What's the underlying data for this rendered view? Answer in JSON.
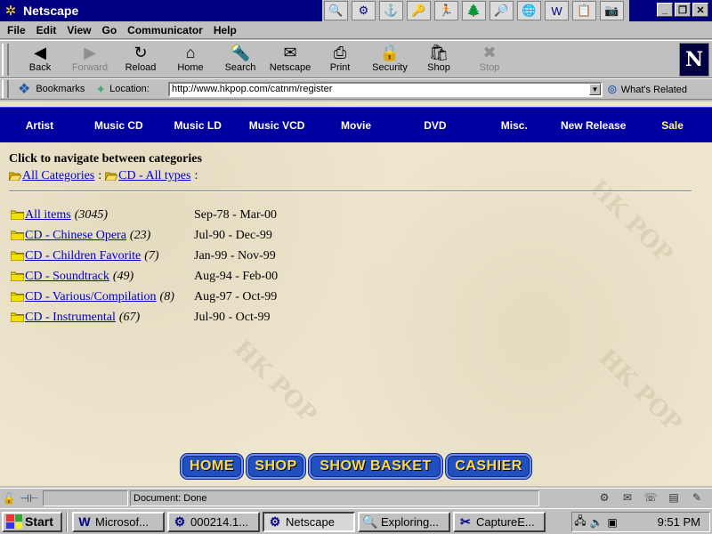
{
  "window": {
    "title": "Netscape",
    "controls": [
      "_",
      "❐",
      "✕"
    ]
  },
  "title_icons": [
    "🔍",
    "⚙",
    "⚓",
    "🔑",
    "🏃",
    "🌲",
    "🔎",
    "🌐",
    "W",
    "📋",
    "📷"
  ],
  "menubar": [
    "File",
    "Edit",
    "View",
    "Go",
    "Communicator",
    "Help"
  ],
  "navbar": {
    "buttons": [
      {
        "label": "Back",
        "icon": "◀",
        "enabled": true
      },
      {
        "label": "Forward",
        "icon": "▶",
        "enabled": false
      },
      {
        "label": "Reload",
        "icon": "↻",
        "enabled": true
      },
      {
        "label": "Home",
        "icon": "⌂",
        "enabled": true
      },
      {
        "label": "Search",
        "icon": "🔦",
        "enabled": true
      },
      {
        "label": "Netscape",
        "icon": "✉",
        "enabled": true
      },
      {
        "label": "Print",
        "icon": "⎙",
        "enabled": true
      },
      {
        "label": "Security",
        "icon": "🔒",
        "enabled": true
      },
      {
        "label": "Shop",
        "icon": "🛍",
        "enabled": true
      },
      {
        "label": "Stop",
        "icon": "✖",
        "enabled": false
      }
    ],
    "logo": "N"
  },
  "locbar": {
    "bookmarks_label": "Bookmarks",
    "location_label": "Location:",
    "url": "http://www.hkpop.com/catnm/register",
    "related_label": "What's Related"
  },
  "catnav": [
    "Artist",
    "Music CD",
    "Music LD",
    "Music VCD",
    "Movie",
    "DVD",
    "Misc.",
    "New Release",
    "Sale"
  ],
  "page": {
    "heading": "Click to navigate between categories",
    "breadcrumb": [
      {
        "label": "All Categories"
      },
      {
        "label": "CD - All types"
      }
    ],
    "breadcrumb_sep": ":",
    "categories": [
      {
        "name": "All items",
        "count": "(3045)",
        "range": "Sep-78 - Mar-00"
      },
      {
        "name": "CD - Chinese Opera",
        "count": "(23)",
        "range": "Jul-90 - Dec-99"
      },
      {
        "name": "CD - Children Favorite",
        "count": "(7)",
        "range": "Jan-99 - Nov-99"
      },
      {
        "name": "CD - Soundtrack",
        "count": "(49)",
        "range": "Aug-94 - Feb-00"
      },
      {
        "name": "CD - Various/Compilation",
        "count": "(8)",
        "range": "Aug-97 - Oct-99"
      },
      {
        "name": "CD - Instrumental",
        "count": "(67)",
        "range": "Jul-90 - Oct-99"
      }
    ],
    "bottom_buttons": [
      "HOME",
      "SHOP",
      "SHOW BASKET",
      "CASHIER"
    ],
    "watermark": "HK POP"
  },
  "status": {
    "text": "Document: Done"
  },
  "taskbar": {
    "start": "Start",
    "tasks": [
      {
        "label": "Microsof...",
        "icon": "W",
        "active": false
      },
      {
        "label": "000214.1...",
        "icon": "⚙",
        "active": false
      },
      {
        "label": "Netscape",
        "icon": "⚙",
        "active": true
      },
      {
        "label": "Exploring...",
        "icon": "🔍",
        "active": false
      },
      {
        "label": "CaptureE...",
        "icon": "✂",
        "active": false
      }
    ],
    "clock": "9:51 PM"
  }
}
